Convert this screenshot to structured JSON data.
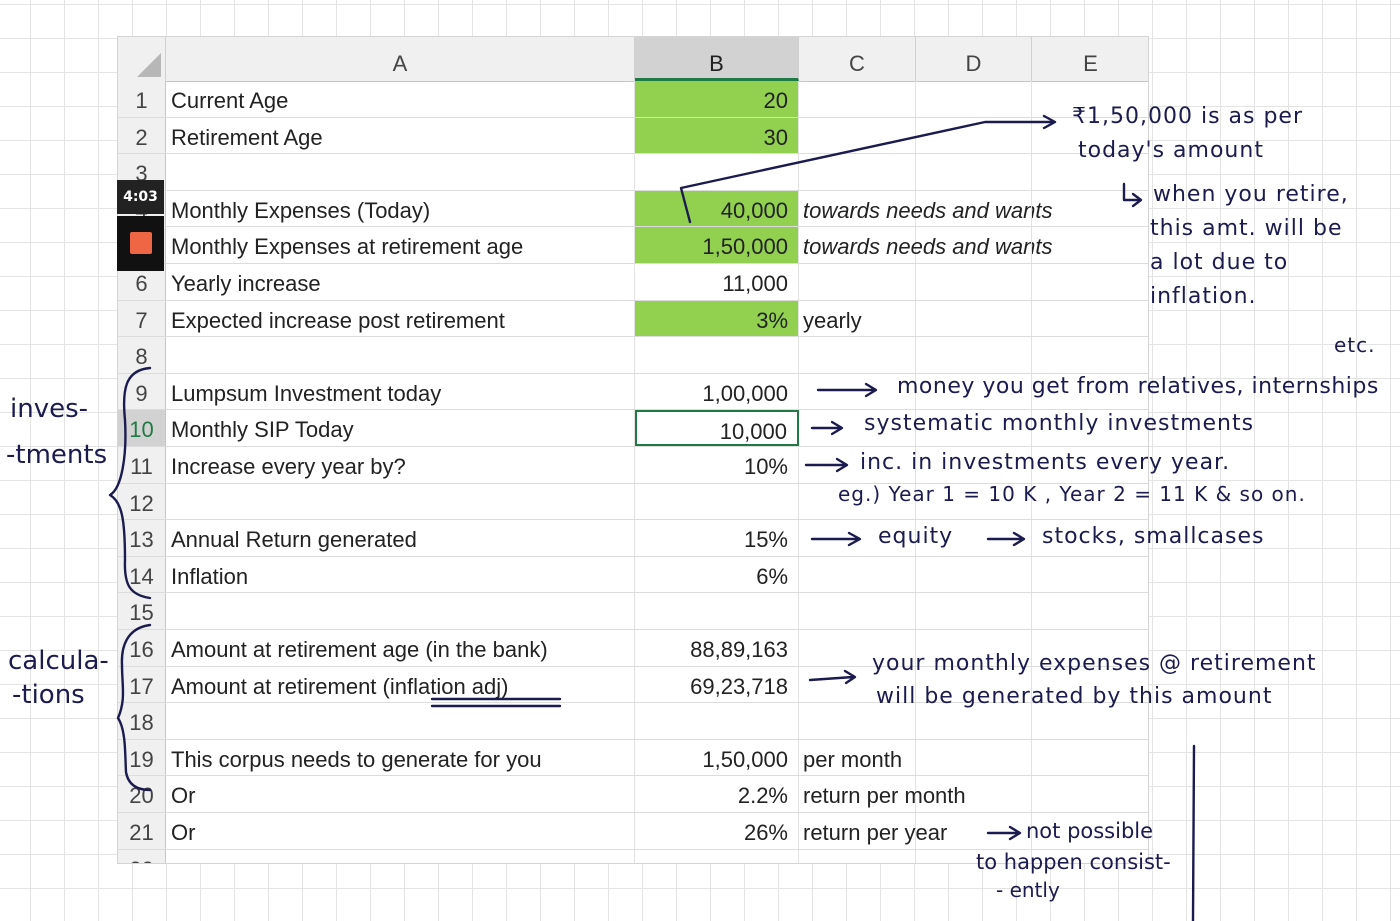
{
  "columns": [
    "A",
    "B",
    "C",
    "D",
    "E"
  ],
  "rows": [
    {
      "n": "1",
      "a": "Current Age",
      "b": "20",
      "c": "",
      "green": true
    },
    {
      "n": "2",
      "a": "Retirement Age",
      "b": "30",
      "c": "",
      "green": true
    },
    {
      "n": "3",
      "a": "",
      "b": "",
      "c": "",
      "green": false
    },
    {
      "n": "4",
      "a": "Monthly Expenses (Today)",
      "b": "40,000",
      "c": "towards needs and wants",
      "green": true,
      "italic": true
    },
    {
      "n": "5",
      "a": "Monthly Expenses at retirement age",
      "b": "1,50,000",
      "c": "towards needs and wants",
      "green": true,
      "italic": true
    },
    {
      "n": "6",
      "a": "Yearly increase",
      "b": "11,000",
      "c": "",
      "green": false
    },
    {
      "n": "7",
      "a": "Expected increase post retirement",
      "b": "3%",
      "c": "yearly",
      "green": true
    },
    {
      "n": "8",
      "a": "",
      "b": "",
      "c": "",
      "green": false
    },
    {
      "n": "9",
      "a": "Lumpsum Investment today",
      "b": "1,00,000",
      "c": "",
      "green": false
    },
    {
      "n": "10",
      "a": "Monthly SIP Today",
      "b": "10,000",
      "c": "",
      "green": false,
      "active": true
    },
    {
      "n": "11",
      "a": "Increase every year by?",
      "b": "10%",
      "c": "",
      "green": false
    },
    {
      "n": "12",
      "a": "",
      "b": "",
      "c": "",
      "green": false
    },
    {
      "n": "13",
      "a": "Annual Return generated",
      "b": "15%",
      "c": "",
      "green": false
    },
    {
      "n": "14",
      "a": "Inflation",
      "b": "6%",
      "c": "",
      "green": false
    },
    {
      "n": "15",
      "a": "",
      "b": "",
      "c": "",
      "green": false
    },
    {
      "n": "16",
      "a": "Amount at retirement age (in the bank)",
      "b": "88,89,163",
      "c": "",
      "green": false
    },
    {
      "n": "17",
      "a": "Amount at retirement (inflation adj)",
      "b": "69,23,718",
      "c": "",
      "green": false
    },
    {
      "n": "18",
      "a": "",
      "b": "",
      "c": "",
      "green": false
    },
    {
      "n": "19",
      "a": "This corpus needs to generate for you",
      "b": "1,50,000",
      "c": "per month",
      "green": false
    },
    {
      "n": "20",
      "a": "Or",
      "b": "2.2%",
      "c": "return per month",
      "green": false
    },
    {
      "n": "21",
      "a": "Or",
      "b": "26%",
      "c": "return per year",
      "green": false
    },
    {
      "n": "22",
      "a": "",
      "b": "",
      "c": "",
      "green": false
    }
  ],
  "video_badge": "4:03",
  "annotations": {
    "note1_line1": "₹1,50,000 is as per",
    "note1_line2": "today's amount",
    "note2_line1": "when you retire,",
    "note2_line2": "this amt. will be",
    "note2_line3": "a lot due to",
    "note2_line4": "inflation.",
    "etc": "etc.",
    "lumpsum": "money you get from relatives, internships",
    "sip": "systematic monthly investments",
    "increase": "inc. in investments every year.",
    "example": "eg.) Year 1 = 10 K , Year 2 = 11 K & so on.",
    "equity": "equity",
    "stocks": "stocks, smallcases",
    "expenses_line1": "your monthly expenses @ retirement",
    "expenses_line2": "will be generated by this amount",
    "not_possible_line1": "not possible",
    "not_possible_line2": "to happen consist-",
    "not_possible_line3": "- ently",
    "invest_label_line1": "inves-",
    "invest_label_line2": "-tments",
    "calc_label_line1": "calcula-",
    "calc_label_line2": "-tions"
  }
}
